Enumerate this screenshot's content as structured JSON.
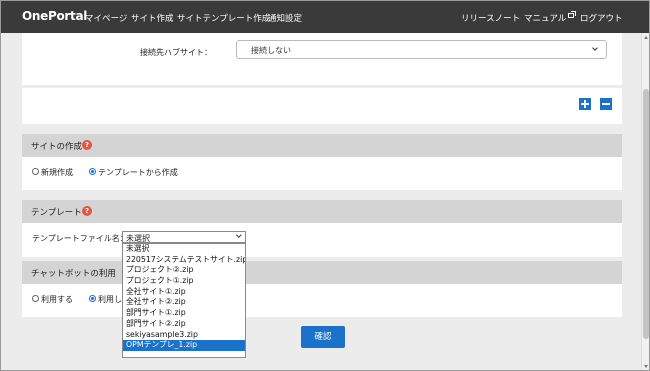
{
  "header": {
    "brand": "OnePortal",
    "nav": [
      "マイページ",
      "サイト作成",
      "サイトテンプレート作成",
      "通知設定"
    ],
    "right_nav": [
      "リリースノート",
      "マニュアル",
      "ログアウト"
    ]
  },
  "hub": {
    "label": "接続先ハブサイト：",
    "value": "接続しない"
  },
  "site_creation": {
    "title": "サイトの作成",
    "help": "?",
    "options": [
      "新規作成",
      "テンプレートから作成"
    ],
    "selected": "テンプレートから作成"
  },
  "template": {
    "title": "テンプレート",
    "help": "?",
    "file_label": "テンプレートファイル名：",
    "selected": "未選択",
    "options": [
      "未選択",
      "220517システムテストサイト.zip",
      "プロジェクト②.zip",
      "プロジェクト①.zip",
      "全社サイト①.zip",
      "全社サイト②.zip",
      "部門サイト①.zip",
      "部門サイト②.zip",
      "sekiyasample3.zip",
      "OPMテンプレ_1.zip"
    ],
    "highlighted": "OPMテンプレ_1.zip"
  },
  "chatbot": {
    "title": "チャットボットの利用",
    "help": "?",
    "options": [
      "利用する",
      "利用し"
    ],
    "selected": "利用し"
  },
  "confirm_label": "確認",
  "colors": {
    "header_bg": "#3a3a3a",
    "accent": "#1a73c9",
    "section_header_bg": "#d4d4d4",
    "help_badge": "#e8543f"
  },
  "icons": {
    "manual_external": "external-link-icon",
    "add": "plus-icon",
    "remove": "minus-icon",
    "help": "help-icon"
  }
}
